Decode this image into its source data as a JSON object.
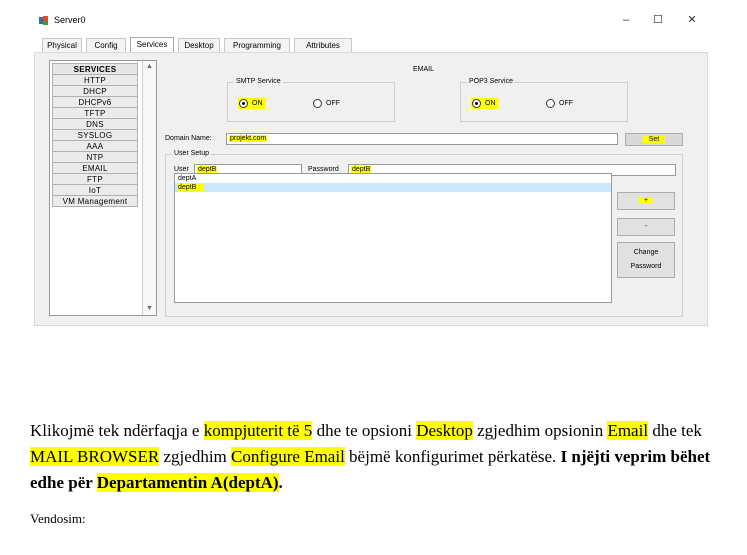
{
  "window": {
    "title": "Server0",
    "minimize": "–",
    "maximize": "☐",
    "close": "✕"
  },
  "tabs": [
    "Physical",
    "Config",
    "Services",
    "Desktop",
    "Programming",
    "Attributes"
  ],
  "active_tab": "Services",
  "services": {
    "header": "SERVICES",
    "items": [
      "HTTP",
      "DHCP",
      "DHCPv6",
      "TFTP",
      "DNS",
      "SYSLOG",
      "AAA",
      "NTP",
      "EMAIL",
      "FTP",
      "IoT",
      "VM Management"
    ]
  },
  "email": {
    "title": "EMAIL",
    "smtp": {
      "label": "SMTP Service",
      "on": "ON",
      "off": "OFF",
      "selected": "ON"
    },
    "pop3": {
      "label": "POP3 Service",
      "on": "ON",
      "off": "OFF",
      "selected": "ON"
    },
    "domain_label": "Domain Name:",
    "domain_value": "projekt.com",
    "set_button": "Set",
    "user_setup_label": "User Setup",
    "user_label": "User",
    "user_value": "deptB",
    "password_label": "Password",
    "password_value": "deptB",
    "users": [
      "deptA",
      "deptB"
    ],
    "selected_user": "deptB",
    "add_button": "+",
    "remove_button": "-",
    "change_password_line1": "Change",
    "change_password_line2": "Password"
  },
  "colors": {
    "highlight": "#ffff00",
    "selection": "#cce8ff"
  },
  "instructions": {
    "p1": "Klikojmë tek ndërfaqja e ",
    "h1": "kompjuterit të 5",
    "p2": " dhe te opsioni ",
    "h2": "Desktop",
    "p3": " zgjedhim opsionin ",
    "h3": "Email",
    "p4": " dhe tek ",
    "h4": "MAIL BROWSER",
    "p5": " zgjedhim ",
    "h5": "Configure Email",
    "p6": " bëjmë konfigurimet përkatëse. ",
    "b1": "I njëjti veprim bëhet edhe për ",
    "h6": "Departamentin A(deptA)",
    "b2": ".",
    "vendosim": "Vendosim:"
  }
}
